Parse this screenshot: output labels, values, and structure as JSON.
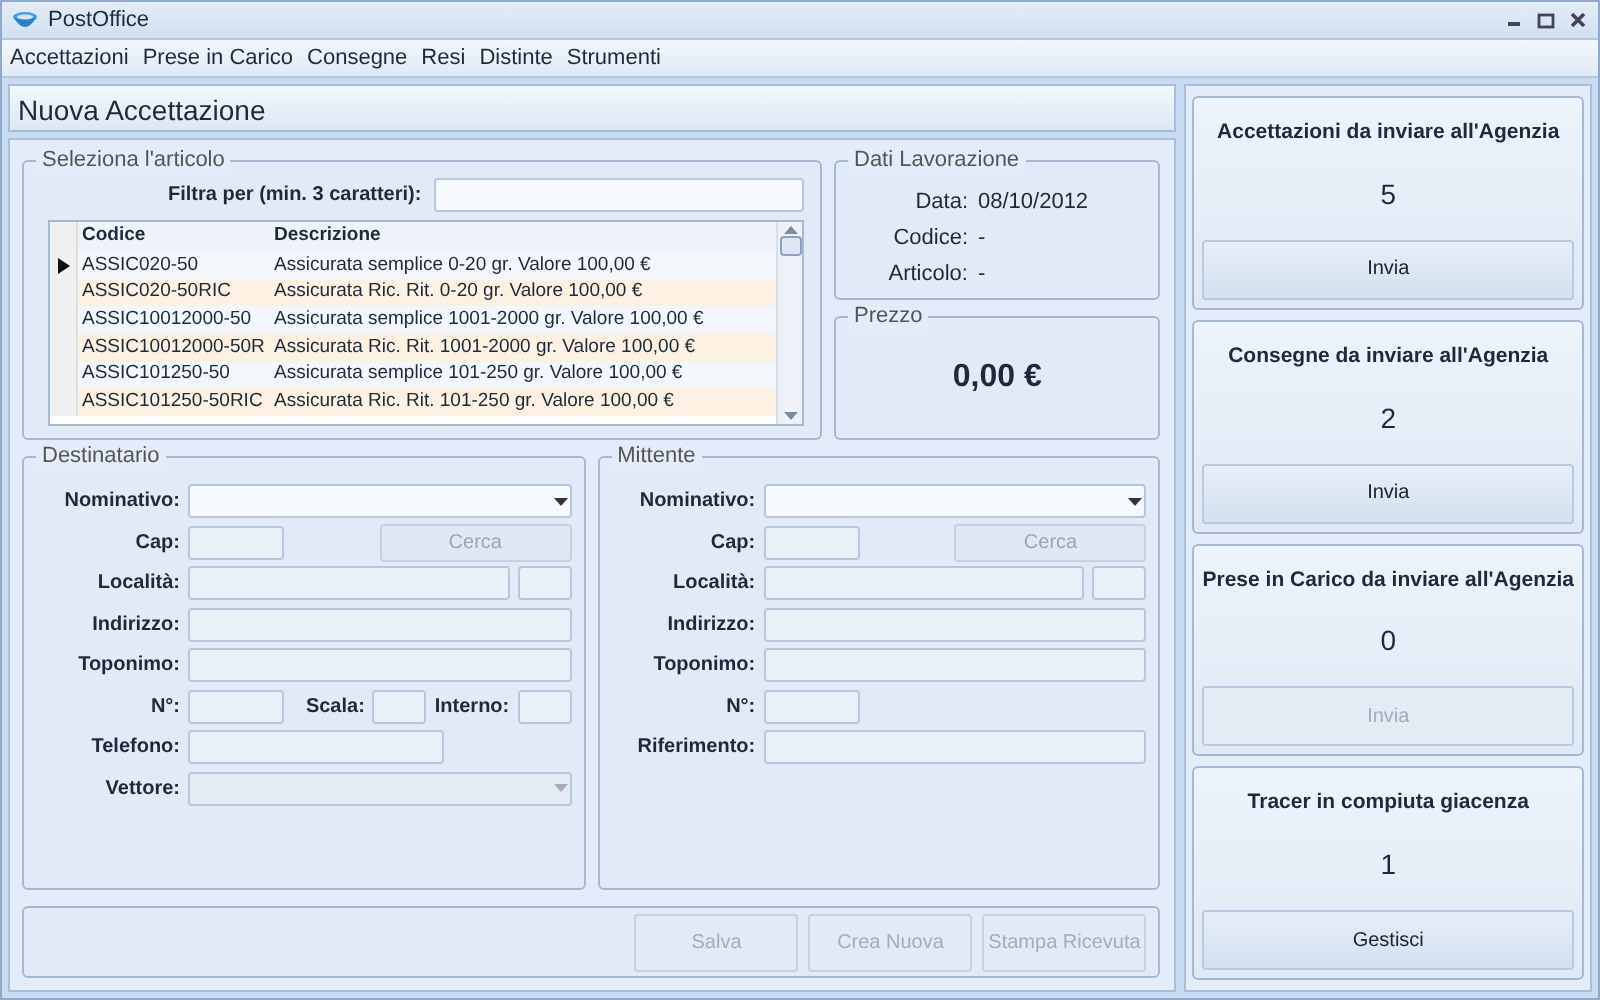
{
  "window": {
    "title": "PostOffice"
  },
  "menu": [
    "Accettazioni",
    "Prese in Carico",
    "Consegne",
    "Resi",
    "Distinte",
    "Strumenti"
  ],
  "page_title": "Nuova Accettazione",
  "article_selector": {
    "legend": "Seleziona l'articolo",
    "filter_label": "Filtra per (min. 3 caratteri):",
    "columns": [
      "Codice",
      "Descrizione"
    ],
    "rows": [
      {
        "code": "ASSIC020-50",
        "description": "Assicurata semplice 0-20 gr. Valore 100,00 €",
        "selected": true
      },
      {
        "code": "ASSIC020-50RIC",
        "description": "Assicurata Ric. Rit. 0-20 gr. Valore 100,00 €",
        "selected": false
      },
      {
        "code": "ASSIC10012000-50",
        "description": "Assicurata semplice 1001-2000 gr. Valore 100,00 €",
        "selected": false
      },
      {
        "code": "ASSIC10012000-50R",
        "description": "Assicurata Ric. Rit. 1001-2000 gr. Valore 100,00 €",
        "selected": false
      },
      {
        "code": "ASSIC101250-50",
        "description": "Assicurata semplice 101-250 gr. Valore 100,00 €",
        "selected": false
      },
      {
        "code": "ASSIC101250-50RIC",
        "description": "Assicurata Ric. Rit. 101-250 gr. Valore 100,00 €",
        "selected": false
      }
    ]
  },
  "work_data": {
    "legend": "Dati Lavorazione",
    "date_label": "Data:",
    "date": "08/10/2012",
    "code_label": "Codice:",
    "code": "-",
    "article_label": "Articolo:",
    "article": "-"
  },
  "price": {
    "legend": "Prezzo",
    "value": "0,00 €"
  },
  "address_groups": [
    {
      "legend": "Destinatario",
      "fields": [
        {
          "label": "Nominativo:",
          "kind": "combo",
          "disabled": false
        },
        {
          "label": "Cap:",
          "kind": "short",
          "button": {
            "label": "Cerca",
            "disabled": true
          }
        },
        {
          "label": "Località:",
          "kind": "split"
        },
        {
          "label": "Indirizzo:",
          "kind": "field"
        },
        {
          "label": "Toponimo:",
          "kind": "field"
        },
        {
          "label": "N°:",
          "kind": "short",
          "subfields": [
            {
              "label": "Scala:"
            },
            {
              "label": "Interno:"
            }
          ]
        },
        {
          "label": "Telefono:",
          "kind": "medium"
        },
        {
          "label": "Vettore:",
          "kind": "combo",
          "disabled": true
        }
      ]
    },
    {
      "legend": "Mittente",
      "fields": [
        {
          "label": "Nominativo:",
          "kind": "combo",
          "disabled": false
        },
        {
          "label": "Cap:",
          "kind": "short",
          "button": {
            "label": "Cerca",
            "disabled": true
          }
        },
        {
          "label": "Località:",
          "kind": "split"
        },
        {
          "label": "Indirizzo:",
          "kind": "field"
        },
        {
          "label": "Toponimo:",
          "kind": "field"
        },
        {
          "label": "N°:",
          "kind": "short"
        },
        {
          "label": "Riferimento:",
          "kind": "field"
        }
      ]
    }
  ],
  "actions": [
    {
      "label": "Salva",
      "disabled": true
    },
    {
      "label": "Crea Nuova",
      "disabled": true
    },
    {
      "label": "Stampa Ricevuta",
      "disabled": true
    }
  ],
  "summary_cards": [
    {
      "title": "Accettazioni da inviare all'Agenzia",
      "count": "5",
      "button": {
        "label": "Invia",
        "disabled": false
      }
    },
    {
      "title": "Consegne da inviare all'Agenzia",
      "count": "2",
      "button": {
        "label": "Invia",
        "disabled": false
      }
    },
    {
      "title": "Prese in Carico da inviare all'Agenzia",
      "count": "0",
      "button": {
        "label": "Invia",
        "disabled": true
      }
    },
    {
      "title": "Tracer in compiuta giacenza",
      "count": "1",
      "button": {
        "label": "Gestisci",
        "disabled": false
      }
    }
  ]
}
